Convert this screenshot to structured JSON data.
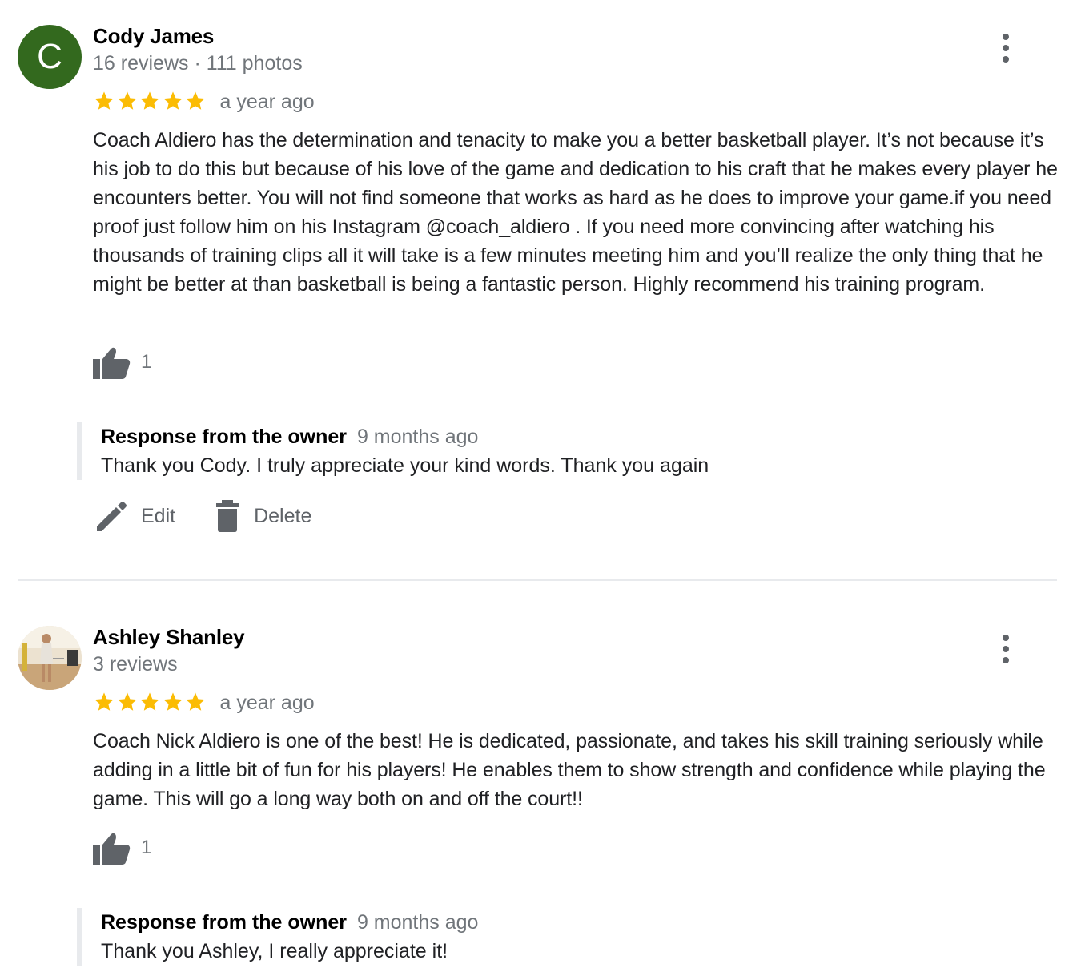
{
  "reviews": [
    {
      "name": "Cody James",
      "meta": "16 reviews · 111 photos",
      "avatar_letter": "C",
      "rating": 5,
      "time": "a year ago",
      "text": "Coach Aldiero has the determination and tenacity to make you a better basketball player. It’s not because it’s his job to do this but because of his love of the game and dedication to his craft that he makes every player he encounters better. You will not find someone that works as hard as he does to improve your game.if you need proof just follow him on his Instagram @coach_aldiero . If you need more convincing after watching his thousands of training clips all it will take is a few minutes meeting him and you’ll realize the only thing that he might be better at than basketball is being a fantastic person. Highly recommend his training program.",
      "likes": "1",
      "response": {
        "label": "Response from the owner",
        "time": "9 months ago",
        "text": "Thank you Cody. I truly appreciate your kind words. Thank you again"
      }
    },
    {
      "name": "Ashley Shanley",
      "meta": "3 reviews",
      "rating": 5,
      "time": "a year ago",
      "text": "Coach Nick Aldiero is one of the best! He is dedicated, passionate, and takes his skill training seriously while adding in a little bit of fun for his players! He enables them to show strength and confidence while playing the game. This will go a long way both on and off the court!!",
      "likes": "1",
      "response": {
        "label": "Response from the owner",
        "time": "9 months ago",
        "text": "Thank you Ashley, I really appreciate it!"
      }
    }
  ],
  "actions": {
    "edit_label": "Edit",
    "delete_label": "Delete"
  },
  "colors": {
    "star": "#fbbc04",
    "avatar_green": "#33691e",
    "secondary_text": "#70757a",
    "icon_gray": "#5f6368",
    "border": "#e8eaed"
  },
  "icons": [
    "more-vert-icon",
    "star-icon",
    "thumb-up-icon",
    "edit-pencil-icon",
    "delete-trash-icon"
  ]
}
